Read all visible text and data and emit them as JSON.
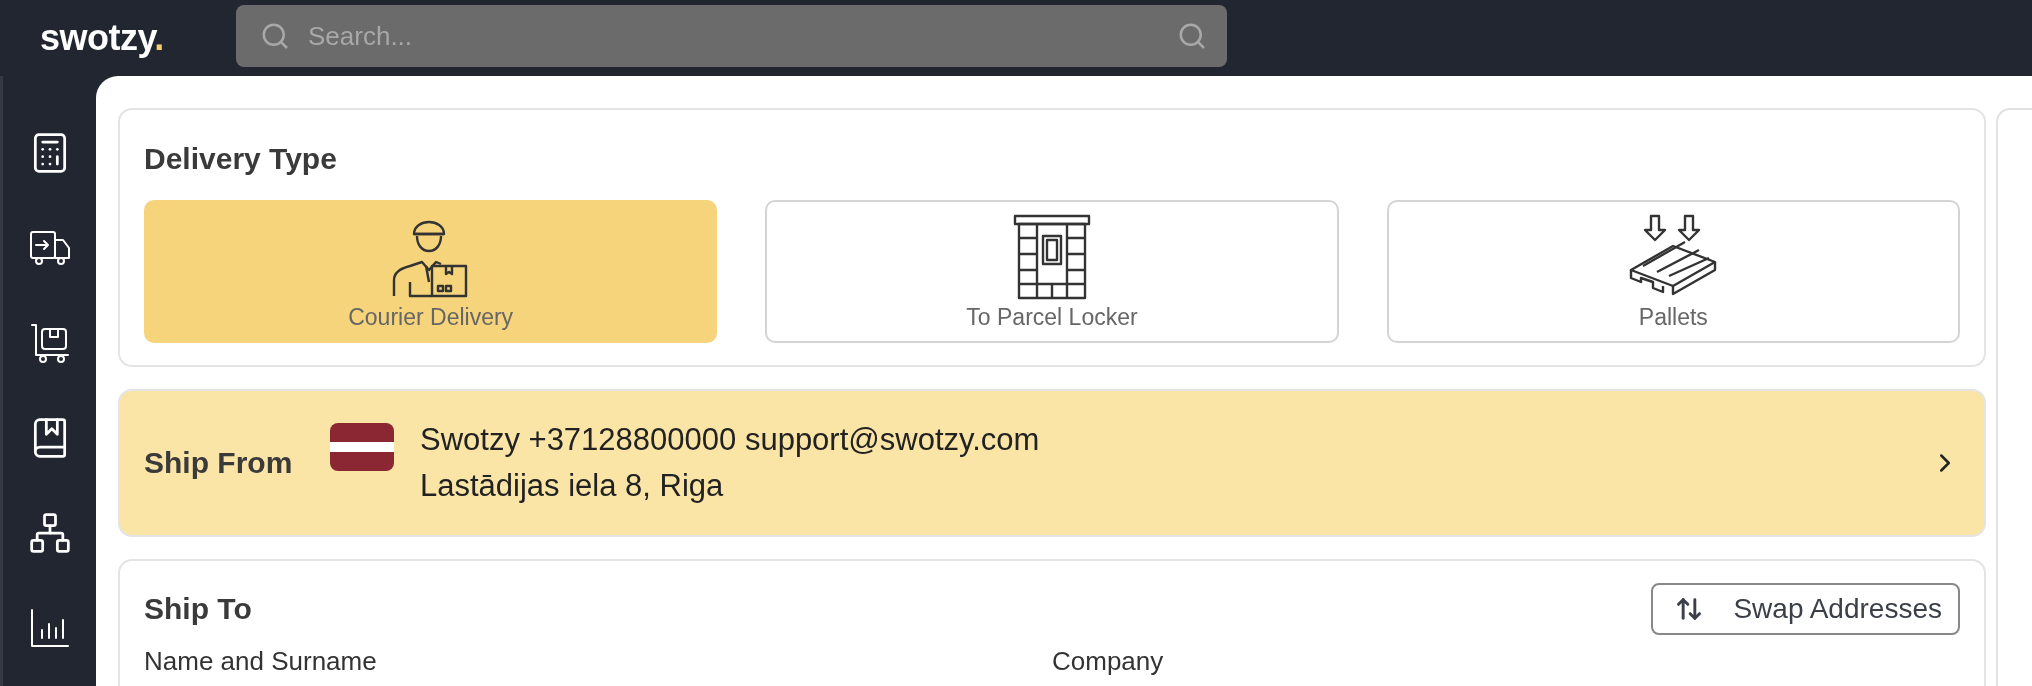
{
  "header": {
    "logo": "swotzy",
    "logo_dot": ".",
    "search": {
      "placeholder": "Search..."
    }
  },
  "sidebar": {
    "items": [
      {
        "kind": "calculator"
      },
      {
        "kind": "truck"
      },
      {
        "kind": "cart"
      },
      {
        "kind": "book"
      },
      {
        "kind": "network"
      },
      {
        "kind": "chart"
      }
    ]
  },
  "delivery_type": {
    "title": "Delivery Type",
    "options": [
      {
        "kind": "courier",
        "label": "Courier Delivery",
        "selected": true
      },
      {
        "kind": "locker",
        "label": "To Parcel Locker",
        "selected": false
      },
      {
        "kind": "pallet",
        "label": "Pallets",
        "selected": false
      }
    ]
  },
  "ship_from": {
    "title": "Ship From",
    "line_1": "Swotzy +37128800000 support@swotzy.com",
    "line_2": "Lastādijas iela 8, Riga"
  },
  "ship_to": {
    "title": "Ship To",
    "swap_button": "Swap Addresses",
    "fields": [
      {
        "label": "Name and Surname"
      },
      {
        "label": "Company"
      }
    ]
  }
}
